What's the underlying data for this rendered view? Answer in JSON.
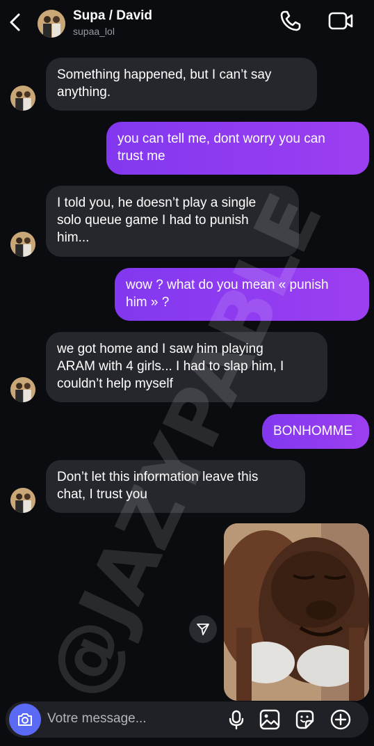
{
  "header": {
    "title": "Supa  / David",
    "username": "supaa_lol"
  },
  "messages": [
    {
      "side": "in",
      "text": "Something happened, but I can’t say\nanything."
    },
    {
      "side": "out",
      "text": "you can tell me, dont worry you can\ntrust me"
    },
    {
      "side": "in",
      "text": "I told you, he doesn’t play a single\nsolo queue game  I had to punish\nhim..."
    },
    {
      "side": "out",
      "text": "wow ? what do you mean « punish\nhim » ?"
    },
    {
      "side": "in",
      "text": "we got home and I saw him playing\nARAM with 4 girls... I had to slap him, I\ncouldn’t help myself"
    },
    {
      "side": "out",
      "text": "BONHOMME"
    },
    {
      "side": "in",
      "text": "Don’t let this information leave this\nchat, I trust you"
    }
  ],
  "watermark": "@JAZYPABLE",
  "composer": {
    "placeholder": "Votre message..."
  },
  "icons": {
    "back": "chevron-left-icon",
    "call": "phone-icon",
    "video": "video-camera-icon",
    "share": "send-icon",
    "camera": "camera-icon",
    "mic": "microphone-icon",
    "gallery": "image-icon",
    "sticker": "sticker-icon",
    "add": "plus-circle-icon"
  },
  "colors": {
    "background": "#0b0c10",
    "incoming_bubble": "#26272d",
    "outgoing_bubble": "#8b3cf0",
    "camera_button": "#5b6af5"
  }
}
